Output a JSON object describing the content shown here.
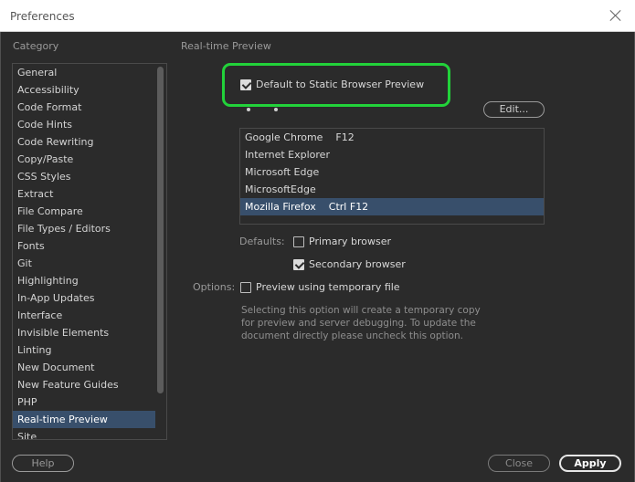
{
  "window": {
    "title": "Preferences"
  },
  "category": {
    "label": "Category",
    "items": [
      "General",
      "Accessibility",
      "Code Format",
      "Code Hints",
      "Code Rewriting",
      "Copy/Paste",
      "CSS Styles",
      "Extract",
      "File Compare",
      "File Types / Editors",
      "Fonts",
      "Git",
      "Highlighting",
      "In-App Updates",
      "Interface",
      "Invisible Elements",
      "Linting",
      "New Document",
      "New Feature Guides",
      "PHP",
      "Real-time Preview",
      "Site"
    ],
    "selected": "Real-time Preview"
  },
  "panel": {
    "title": "Real-time Preview",
    "default_static": {
      "label": "Default to Static Browser Preview",
      "checked": true
    },
    "edit_label": "Edit...",
    "browsers": [
      "Google Chrome    F12",
      "Internet Explorer",
      "Microsoft Edge",
      "MicrosoftEdge",
      "Mozilla Firefox    Ctrl F12"
    ],
    "selected_browser_index": 4,
    "defaults_label": "Defaults:",
    "primary_browser": {
      "label": "Primary browser",
      "checked": false
    },
    "secondary_browser": {
      "label": "Secondary browser",
      "checked": true
    },
    "options_label": "Options:",
    "temp_file": {
      "label": "Preview using temporary file",
      "checked": false
    },
    "help_text": "Selecting this option will create a temporary copy for preview and server debugging. To update the document directly please uncheck this option."
  },
  "footer": {
    "help_label": "Help",
    "close_label": "Close",
    "apply_label": "Apply"
  },
  "colors": {
    "highlight": "#22d23a",
    "selection": "#384f6b",
    "background": "#2b2b2b"
  }
}
